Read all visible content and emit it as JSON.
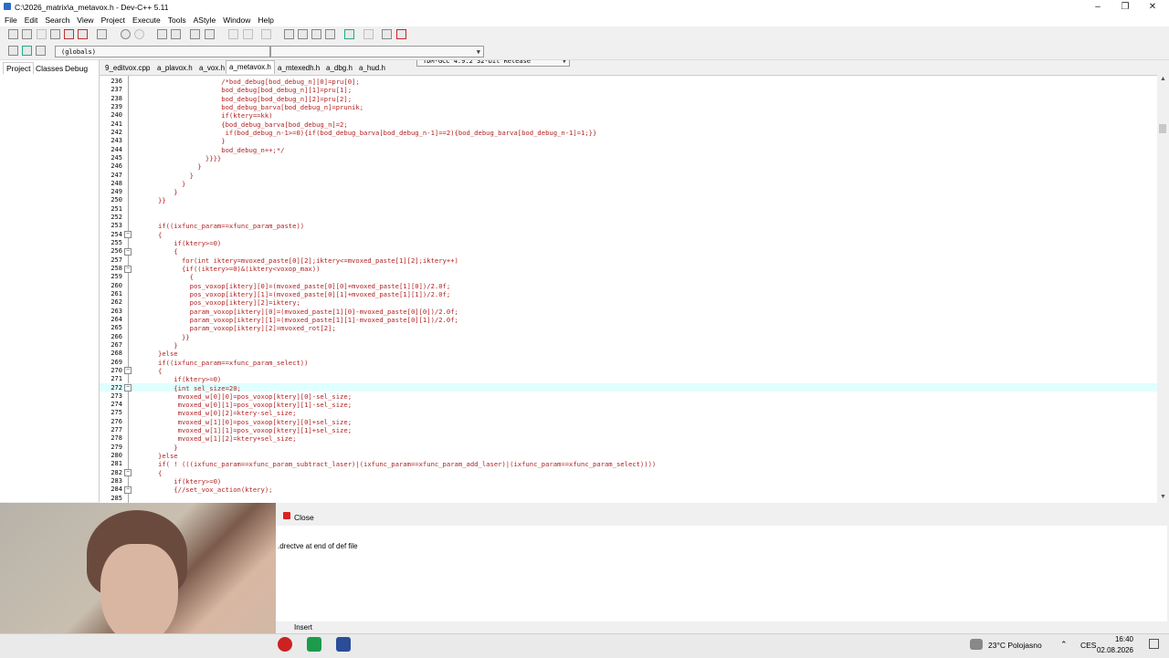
{
  "window": {
    "title": "C:\\2026_matrix\\a_metavox.h - Dev-C++ 5.11",
    "minimize": "–",
    "maximize": "❐",
    "close": "✕"
  },
  "menu": [
    "File",
    "Edit",
    "Search",
    "View",
    "Project",
    "Execute",
    "Tools",
    "AStyle",
    "Window",
    "Help"
  ],
  "toolbar": {
    "compiler": "TDM-GCC 4.9.2 32-bit Release",
    "scope": "(globals)"
  },
  "left_tabs": [
    "Project",
    "Classes",
    "Debug"
  ],
  "file_tabs": [
    "9_editvox.cpp",
    "a_plavox.h",
    "a_vox.h",
    "a_metavox.h",
    "a_mtexedh.h",
    "a_dbg.h",
    "a_hud.h"
  ],
  "active_file_tab": 3,
  "editor": {
    "lines": [
      {
        "n": "236",
        "code": "                /*bod_debug[bod_debug_n][0]=pru[0];"
      },
      {
        "n": "237",
        "code": "                bod_debug[bod_debug_n][1]=pru[1];"
      },
      {
        "n": "238",
        "code": "                bod_debug[bod_debug_n][2]=pru[2];"
      },
      {
        "n": "239",
        "code": "                bod_debug_barva[bod_debug_n]=prunik;"
      },
      {
        "n": "240",
        "code": "                if(ktery==kk)"
      },
      {
        "n": "241",
        "code": "                {bod_debug_barva[bod_debug_n]=2;"
      },
      {
        "n": "242",
        "code": "                 if(bod_debug_n-1>=0){if(bod_debug_barva[bod_debug_n-1]==2){bod_debug_barva[bod_debug_n-1]=1;}}"
      },
      {
        "n": "243",
        "code": "                }"
      },
      {
        "n": "244",
        "code": "                bod_debug_n++;*/"
      },
      {
        "n": "245",
        "code": "            }}}}"
      },
      {
        "n": "246",
        "code": "          }"
      },
      {
        "n": "247",
        "code": "        }"
      },
      {
        "n": "248",
        "code": "      }"
      },
      {
        "n": "249",
        "code": "    }"
      },
      {
        "n": "250",
        "code": "}}"
      },
      {
        "n": "251",
        "code": ""
      },
      {
        "n": "252",
        "code": ""
      },
      {
        "n": "253",
        "code": "if((ixfunc_param==xfunc_param_paste))"
      },
      {
        "n": "254",
        "code": "{"
      },
      {
        "n": "255",
        "code": "    if(ktery>=0)"
      },
      {
        "n": "256",
        "code": "    {"
      },
      {
        "n": "257",
        "code": "      for(int iktery=mvoxed_paste[0][2];iktery<=mvoxed_paste[1][2];iktery++)"
      },
      {
        "n": "258",
        "code": "      {if((iktery>=0)&(iktery<voxop_max))"
      },
      {
        "n": "259",
        "code": "        {"
      },
      {
        "n": "260",
        "code": "        pos_voxop[iktery][0]=(mvoxed_paste[0][0]+mvoxed_paste[1][0])/2.0f;"
      },
      {
        "n": "261",
        "code": "        pos_voxop[iktery][1]=(mvoxed_paste[0][1]+mvoxed_paste[1][1])/2.0f;"
      },
      {
        "n": "262",
        "code": "        pos_voxop[iktery][2]=iktery;"
      },
      {
        "n": "263",
        "code": "        param_voxop[iktery][0]=(mvoxed_paste[1][0]-mvoxed_paste[0][0])/2.0f;"
      },
      {
        "n": "264",
        "code": "        param_voxop[iktery][1]=(mvoxed_paste[1][1]-mvoxed_paste[0][1])/2.0f;"
      },
      {
        "n": "265",
        "code": "        param_voxop[iktery][2]=mvoxed_rot[2];"
      },
      {
        "n": "266",
        "code": "      }}"
      },
      {
        "n": "267",
        "code": "    }"
      },
      {
        "n": "268",
        "code": "}else"
      },
      {
        "n": "269",
        "code": "if((ixfunc_param==xfunc_param_select))"
      },
      {
        "n": "270",
        "code": "{"
      },
      {
        "n": "271",
        "code": "    if(ktery>=0)"
      },
      {
        "n": "272",
        "code": "    {int sel_size=20;"
      },
      {
        "n": "273",
        "code": "     mvoxed_w[0][0]=pos_voxop[ktery][0]-sel_size;"
      },
      {
        "n": "274",
        "code": "     mvoxed_w[0][1]=pos_voxop[ktery][1]-sel_size;"
      },
      {
        "n": "275",
        "code": "     mvoxed_w[0][2]=ktery-sel_size;"
      },
      {
        "n": "276",
        "code": "     mvoxed_w[1][0]=pos_voxop[ktery][0]+sel_size;"
      },
      {
        "n": "277",
        "code": "     mvoxed_w[1][1]=pos_voxop[ktery][1]+sel_size;"
      },
      {
        "n": "278",
        "code": "     mvoxed_w[1][2]=ktery+sel_size;"
      },
      {
        "n": "279",
        "code": "    }"
      },
      {
        "n": "280",
        "code": "}else"
      },
      {
        "n": "281",
        "code": "if( ! (((ixfunc_param==xfunc_param_subtract_laser)|(ixfunc_param==xfunc_param_add_laser)|(ixfunc_param==xfunc_param_select))))"
      },
      {
        "n": "282",
        "code": "{"
      },
      {
        "n": "283",
        "code": "    if(ktery>=0)"
      },
      {
        "n": "284",
        "code": "    {//set_vox_action(ktery);"
      },
      {
        "n": "285",
        "code": ""
      }
    ],
    "highlighted_line": "272"
  },
  "bottom": {
    "close_label": "Close",
    "message": ".drectve at end of def file",
    "status_mode": "Insert"
  },
  "taskbar": {
    "weather": "23°C  Polojasno",
    "lang": "CES",
    "time": "16:40",
    "date": "02.08.2026"
  },
  "colors": {
    "keyword_red": "#b22222",
    "float_literal": "#5a7fa8",
    "line_highlight": "#e0ffff",
    "accent_blue": "#2b6cc4"
  }
}
